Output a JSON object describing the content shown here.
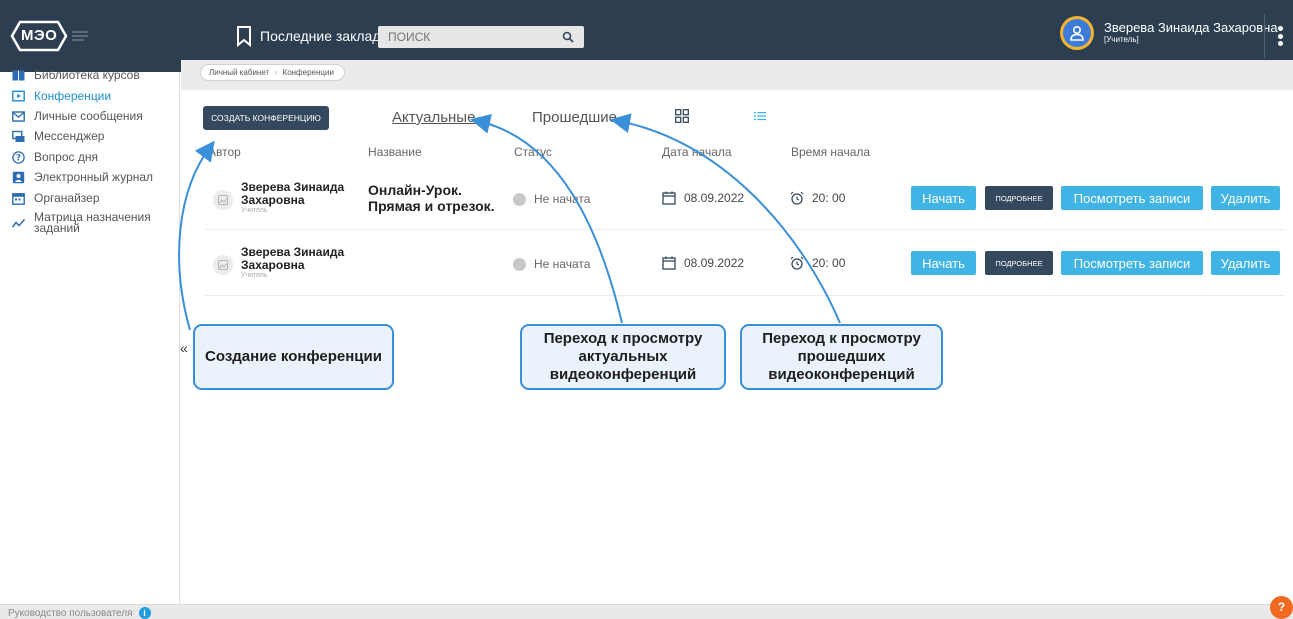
{
  "app": {
    "logo_text": "МЭО",
    "colors": {
      "topbar": "#2c3e50",
      "accent": "#40b4e5",
      "dark_button": "#34495e",
      "active_link": "#1f8fd0",
      "callout_border": "#3a8fd9",
      "help": "#f26a21"
    }
  },
  "header": {
    "bookmarks_label": "Последние закладки",
    "search_placeholder": "поиск",
    "user_name": "Зверева Зинаида Захаровна",
    "user_role": "[Учитель]"
  },
  "sidebar": {
    "items": [
      {
        "label": "Библиотека курсов",
        "icon": "book-icon",
        "active": false
      },
      {
        "label": "Конференции",
        "icon": "play-screen-icon",
        "active": true
      },
      {
        "label": "Личные сообщения",
        "icon": "envelope-icon",
        "active": false
      },
      {
        "label": "Мессенджер",
        "icon": "chat-icon",
        "active": false
      },
      {
        "label": "Вопрос дня",
        "icon": "question-icon",
        "active": false
      },
      {
        "label": "Электронный журнал",
        "icon": "journal-icon",
        "active": false
      },
      {
        "label": "Органайзер",
        "icon": "calendar-icon",
        "active": false
      },
      {
        "label": "Матрица назначения заданий",
        "icon": "trend-icon",
        "active": false
      }
    ],
    "collapse_label": "«"
  },
  "breadcrumb": {
    "items": [
      "Личный кабинет",
      "Конференции"
    ]
  },
  "main": {
    "create_button": "Создать конференцию",
    "tabs": [
      {
        "label": "Актуальные",
        "active": true
      },
      {
        "label": "Прошедшие",
        "active": false
      }
    ],
    "columns": [
      "Автор",
      "Название",
      "Статус",
      "Дата начала",
      "Время начала"
    ],
    "rows": [
      {
        "author": "Зверева Зинаида Захаровна",
        "role": "Учитель",
        "title": "Онлайн-Урок. Прямая и отрезок.",
        "status": "Не начата",
        "date": "08.09.2022",
        "time": "20: 00",
        "actions": {
          "start": "Начать",
          "details": "Подробнее",
          "records": "Посмотреть записи",
          "delete": "Удалить"
        }
      },
      {
        "author": "Зверева Зинаида Захаровна",
        "role": "Учитель",
        "title": "",
        "status": "Не начата",
        "date": "08.09.2022",
        "time": "20: 00",
        "actions": {
          "start": "Начать",
          "details": "Подробнее",
          "records": "Посмотреть записи",
          "delete": "Удалить"
        }
      }
    ]
  },
  "callouts": {
    "create": "Создание конференции",
    "actual": "Переход к просмотру актуальных видеоконференций",
    "past": "Переход к просмотру прошедших видеоконференций"
  },
  "footer": {
    "guide_label": "Руководство пользователя",
    "info_icon": "i",
    "help_label": "?"
  }
}
